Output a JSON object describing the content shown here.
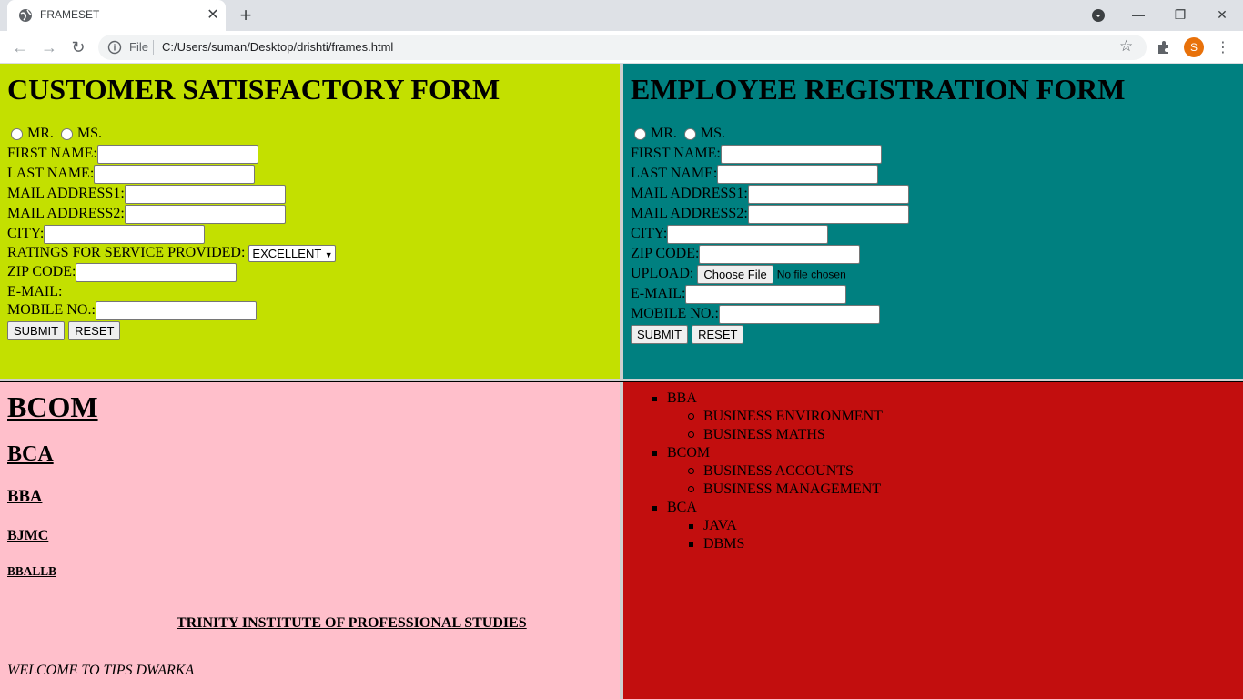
{
  "browser": {
    "tab_title": "FRAMESET",
    "tab_close": "✕",
    "new_tab": "+",
    "omnibox_scheme": "File",
    "url": "C:/Users/suman/Desktop/drishti/frames.html",
    "avatar_letter": "S",
    "window_controls": [
      "—",
      "❐",
      "✕"
    ]
  },
  "customer_form": {
    "title": "CUSTOMER SATISFACTORY FORM",
    "bg": "#c3e000",
    "radio_mr": "MR.",
    "radio_ms": "MS.",
    "first_name": "FIRST NAME:",
    "last_name": "LAST NAME:",
    "mail1": "MAIL ADDRESS1:",
    "mail2": "MAIL ADDRESS2:",
    "city": "CITY:",
    "ratings": "RATINGS FOR SERVICE PROVIDED:",
    "ratings_selected": "EXCELLENT",
    "zip": "ZIP CODE:",
    "email": "E-MAIL:",
    "mobile": "MOBILE NO.:",
    "submit": "SUBMIT",
    "reset": "RESET"
  },
  "employee_form": {
    "title": "EMPLOYEE REGISTRATION FORM",
    "bg": "#008080",
    "radio_mr": "MR.",
    "radio_ms": "MS.",
    "first_name": "FIRST NAME:",
    "last_name": "LAST NAME:",
    "mail1": "MAIL ADDRESS1:",
    "mail2": "MAIL ADDRESS2:",
    "city": "CITY:",
    "zip": "ZIP CODE:",
    "upload": "UPLOAD:",
    "choose_file": "Choose File",
    "no_file": "No file chosen",
    "email": "E-MAIL:",
    "mobile": "MOBILE NO.:",
    "submit": "SUBMIT",
    "reset": "RESET"
  },
  "courses_frame": {
    "bg": "#ffbfcb",
    "h1": "BCOM",
    "h2": "BCA",
    "h3": "BBA",
    "h4": "BJMC",
    "h5": "BBALLB",
    "institute": "TRINITY INSTITUTE OF PROFESSIONAL STUDIES",
    "welcome": "WELCOME TO TIPS DWARKA"
  },
  "list_frame": {
    "bg": "#c20e0e",
    "items": [
      {
        "label": "BBA",
        "subs": [
          "BUSINESS ENVIRONMENT",
          "BUSINESS MATHS"
        ]
      },
      {
        "label": "BCOM",
        "subs": [
          "BUSINESS ACCOUNTS",
          "BUSINESS MANAGEMENT"
        ]
      },
      {
        "label": "BCA",
        "subs": [
          "JAVA",
          "DBMS"
        ]
      }
    ]
  }
}
